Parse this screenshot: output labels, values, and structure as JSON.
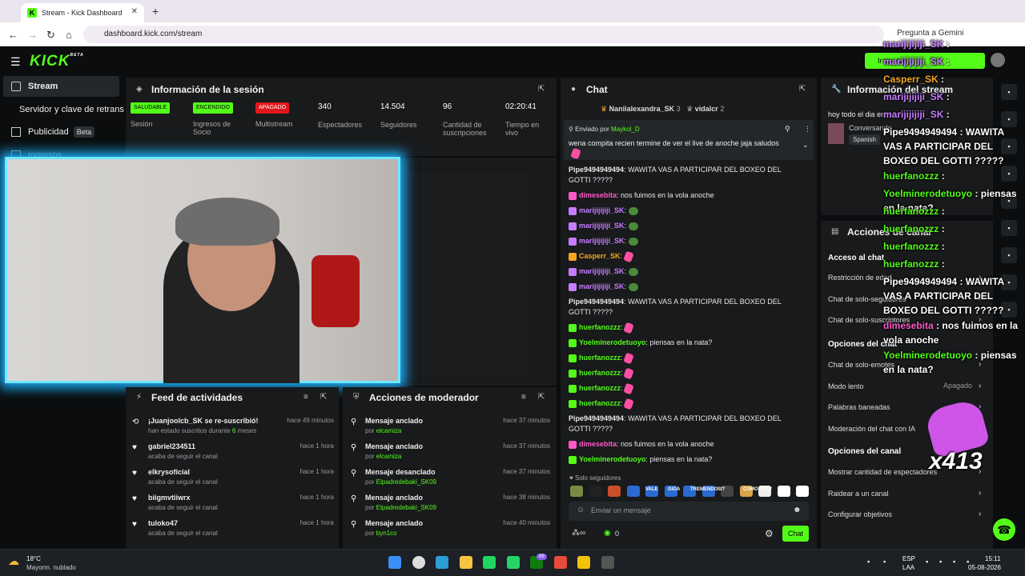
{
  "browser": {
    "tab_title": "Stream - Kick Dashboard",
    "url": "dashboard.kick.com/stream",
    "gemini": "Pregunta a Gemini"
  },
  "header": {
    "logo": "KICK",
    "logo_beta": "BETA",
    "go_live": "Ir en vivo"
  },
  "sidebar": {
    "items": [
      {
        "label": "Stream"
      },
      {
        "label": "Servidor y clave de retransmisión"
      },
      {
        "label": "Publicidad",
        "badge": "Beta"
      },
      {
        "label": "Ingresos"
      }
    ]
  },
  "session": {
    "title": "Información de la sesión",
    "stats": [
      {
        "badge": "SALUDABLE",
        "label": "Sesión"
      },
      {
        "badge": "ENCENDIDO",
        "label": "Ingresos de Socio"
      },
      {
        "badge": "APAGADO",
        "label": "Multistream"
      },
      {
        "value": "340",
        "label": "Espectadores"
      },
      {
        "value": "14.504",
        "label": "Seguidores"
      },
      {
        "value": "96",
        "label": "Cantidad de suscripciones"
      },
      {
        "value": "02:20:41",
        "label": "Tiempo en vivo"
      }
    ]
  },
  "feed": {
    "title": "Feed de actividades",
    "rows": [
      {
        "title": "¡Juanjoolcb_SK se re-suscribió!",
        "sub": "han estado suscritos durante",
        "months": "6",
        "months_unit": "meses",
        "time": "hace 49 minutos"
      },
      {
        "title": "gabriel234511",
        "sub": "acaba de seguir el canal",
        "time": "hace 1 hora"
      },
      {
        "title": "elkrysoficial",
        "sub": "acaba de seguir el canal",
        "time": "hace 1 hora"
      },
      {
        "title": "biigmvtiiwrx",
        "sub": "acaba de seguir el canal",
        "time": "hace 1 hora"
      },
      {
        "title": "tuloko47",
        "sub": "acaba de seguir el canal",
        "time": "hace 1 hora"
      }
    ]
  },
  "mod": {
    "title": "Acciones de moderador",
    "rows": [
      {
        "title": "Mensaje anclado",
        "by": "por",
        "user": "elcamiza",
        "time": "hace 37 minutos"
      },
      {
        "title": "Mensaje anclado",
        "by": "por",
        "user": "elcamiza",
        "time": "hace 37 minutos"
      },
      {
        "title": "Mensaje desanclado",
        "by": "por",
        "user": "Elpadredebaki_SK09",
        "time": "hace 37 minutos"
      },
      {
        "title": "Mensaje anclado",
        "by": "por",
        "user": "Elpadredebaki_SK09",
        "time": "hace 38 minutos"
      },
      {
        "title": "Mensaje anclado",
        "by": "por",
        "user": "byn1co",
        "time": "hace 40 minutos"
      }
    ]
  },
  "chat": {
    "title": "Chat",
    "top_users": [
      {
        "name": "Naniialexandra_SK",
        "count": "3"
      },
      {
        "name": "vidalcr",
        "count": "2"
      }
    ],
    "pinned_by_label": "Enviado por",
    "pinned_by": "Maykol_D",
    "pinned_text": "wena compita recien termine de ver el live de anoche jaja saludos",
    "messages": [
      {
        "user": "Pipe9494949494",
        "text": "WAWITA VAS A PARTICIPAR DEL BOXEO DEL GOTTI ?????",
        "color": "#e8e8e8"
      },
      {
        "user": "dimesebita",
        "text": "nos fuimos en la vola anoche",
        "color": "#ff5ac8"
      },
      {
        "user": "marijijijiji_SK",
        "text": "",
        "color": "#c77dff"
      },
      {
        "user": "marijijijiji_SK",
        "text": "",
        "color": "#c77dff"
      },
      {
        "user": "marijijijiji_SK",
        "text": "",
        "color": "#c77dff"
      },
      {
        "user": "Casperr_SK",
        "text": "",
        "color": "#f5a623"
      },
      {
        "user": "marijijijiji_SK",
        "text": "",
        "color": "#c77dff"
      },
      {
        "user": "marijijijiji_SK",
        "text": "",
        "color": "#c77dff"
      },
      {
        "user": "Pipe9494949494",
        "text": "WAWITA VAS A PARTICIPAR DEL BOXEO DEL GOTTI ?????",
        "color": "#e8e8e8"
      },
      {
        "user": "huerfanozzz",
        "text": "",
        "color": "#53fc18"
      },
      {
        "user": "Yoelminerodetuoyo",
        "text": "piensas en la nata?",
        "color": "#53fc18"
      },
      {
        "user": "huerfanozzz",
        "text": "",
        "color": "#53fc18"
      },
      {
        "user": "huerfanozzz",
        "text": "",
        "color": "#53fc18"
      },
      {
        "user": "huerfanozzz",
        "text": "",
        "color": "#53fc18"
      },
      {
        "user": "huerfanozzz",
        "text": "",
        "color": "#53fc18"
      },
      {
        "user": "Pipe9494949494",
        "text": "WAWITA VAS A PARTICIPAR DEL BOXEO DEL GOTTI ?????",
        "color": "#e8e8e8"
      },
      {
        "user": "dimesebita",
        "text": "nos fuimos en la vola anoche",
        "color": "#ff5ac8"
      },
      {
        "user": "Yoelminerodetuoyo",
        "text": "piensas en la nata?",
        "color": "#53fc18"
      }
    ],
    "mode": "Solo seguidores",
    "emotes": [
      "VALE",
      "GIGA",
      "TREMENDO",
      "SI?",
      "COMO FUE?"
    ],
    "input_placeholder": "Enviar un mensaje",
    "count": "0",
    "send": "Chat"
  },
  "stream_info": {
    "title": "Información del stream",
    "stream_title": "hoy todo el dia en",
    "category": "Conversando",
    "language": "Spanish"
  },
  "channel_actions": {
    "title": "Acciones de canal",
    "chat_access": "Acceso al chat",
    "items1": [
      "Restricción de edad",
      "Chat de solo-seguidores",
      "Chat de solo-suscriptores"
    ],
    "chat_options": "Opciones del chat",
    "items2": [
      "Chat de solo-emotes",
      "Modo lento",
      "Palabras baneadas",
      "Moderación del chat con IA"
    ],
    "slow_mode": "Apagado",
    "channel_options": "Opciones del canal",
    "items3": [
      "Mostrar cantidad de espectadores",
      "Raidear a un canal",
      "Configurar objetivos"
    ]
  },
  "overlay": {
    "lines": [
      {
        "user": "marijijijiji_SK",
        "text": ":",
        "color": "#c77dff"
      },
      {
        "user": "marijijijiji_SK",
        "text": ":",
        "color": "#c77dff"
      },
      {
        "user": "Casperr_SK",
        "text": ":",
        "color": "#f5a623"
      },
      {
        "user": "marijijijiji_SK",
        "text": ":",
        "color": "#c77dff"
      },
      {
        "user": "marijijijiji_SK",
        "text": ":",
        "color": "#c77dff"
      },
      {
        "user": "Pipe9494949494",
        "text": ": WAWITA VAS A PARTICIPAR DEL BOXEO DEL GOTTI ?????",
        "color": "#ffffff"
      },
      {
        "user": "huerfanozzz",
        "text": ":",
        "color": "#53fc18"
      },
      {
        "user": "Yoelminerodetuoyo",
        "text": ": piensas en la nata?",
        "color": "#53fc18"
      },
      {
        "user": "huerfanozzz",
        "text": ":",
        "color": "#53fc18"
      },
      {
        "user": "huerfanozzz",
        "text": ":",
        "color": "#53fc18"
      },
      {
        "user": "huerfanozzz",
        "text": ":",
        "color": "#53fc18"
      },
      {
        "user": "huerfanozzz",
        "text": ":",
        "color": "#53fc18"
      },
      {
        "user": "Pipe9494949494",
        "text": ": WAWITA VAS A PARTICIPAR DEL BOXEO DEL GOTTI ?????",
        "color": "#ffffff"
      },
      {
        "user": "dimesebita",
        "text": ": nos fuimos en la vola anoche",
        "color": "#ff5ac8"
      },
      {
        "user": "Yoelminerodetuoyo",
        "text": ": piensas en la nata?",
        "color": "#53fc18"
      }
    ],
    "combo": "x413"
  },
  "taskbar": {
    "temp": "18°C",
    "weather": "Mayorm. nublado",
    "lang": "ESP",
    "lang2": "LAA",
    "time": "15:11",
    "date": "05-08-2026",
    "badge": "99"
  }
}
